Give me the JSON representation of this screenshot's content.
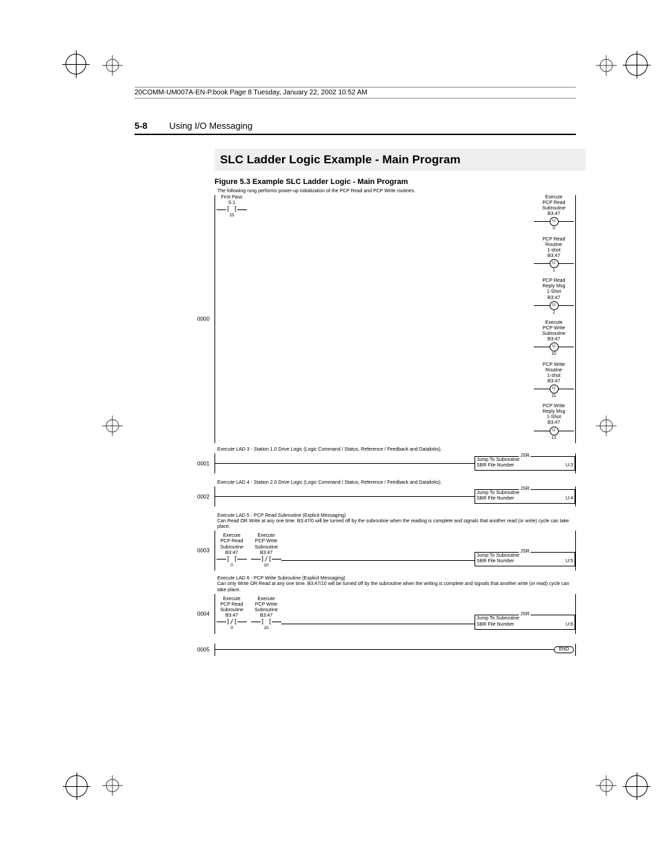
{
  "header_line": "20COMM-UM007A-EN-P.book  Page 8  Tuesday, January 22, 2002  10:52 AM",
  "page_number": "5-8",
  "chapter_title": "Using I/O Messaging",
  "section_title": "SLC Ladder Logic Example - Main Program",
  "figure_caption": "Figure 5.3   Example SLC Ladder Logic - Main Program",
  "rung0": {
    "num": "0000",
    "desc": "The following rung performs power-up initialization of the PCP Read and PCP Write routines.",
    "contact": {
      "l1": "First Pass",
      "l2": "S:1",
      "sub": "15"
    },
    "outputs": [
      {
        "l1": "Execute",
        "l2": "PCP Read",
        "l3": "Subroutine",
        "addr": "B3:47",
        "coil": "U",
        "sub": "0"
      },
      {
        "l1": "PCP Read",
        "l2": "Routine",
        "l3": "1-shot",
        "addr": "B3:47",
        "coil": "U",
        "sub": "1"
      },
      {
        "l1": "PCP Read",
        "l2": "Reply Msg",
        "l3": "1-Shot",
        "addr": "B3:47",
        "coil": "U",
        "sub": "2"
      },
      {
        "l1": "Execute",
        "l2": "PCP Write",
        "l3": "Subroutine",
        "addr": "B3:47",
        "coil": "U",
        "sub": "10"
      },
      {
        "l1": "PCP Write",
        "l2": "Routine",
        "l3": "1-shot",
        "addr": "B3:47",
        "coil": "U",
        "sub": "11"
      },
      {
        "l1": "PCP Write",
        "l2": "Reply Msg",
        "l3": "1-Shot",
        "addr": "B3:47",
        "coil": "U",
        "sub": "12"
      }
    ]
  },
  "rung1": {
    "num": "0001",
    "desc": "Execute LAD 3 - Station 1.0 Drive Logic (Logic Command / Status, Reference / Feedback and Datalinks).",
    "jsr": {
      "label": "JSR",
      "l1": "Jump To Subroutine",
      "l2": "SBR File Number",
      "v": "U:3"
    }
  },
  "rung2": {
    "num": "0002",
    "desc": "Execute LAD 4 - Station 2.0 Drive Logic  (Logic Command / Status, Reference / Feedback and Datalinks).",
    "jsr": {
      "label": "JSR",
      "l1": "Jump To Subroutine",
      "l2": "SBR File Number",
      "v": "U:4"
    }
  },
  "rung3": {
    "num": "0003",
    "desc": "Execute LAD 5 - PCP Read Subroutine (Explicit Messaging)\nCan Read OR Write at any one time.  B3:47/0 will be turned off by the subroutine when the reading is complete and signals that another read (or write) cycle can take place.",
    "c1": {
      "l1": "Execute",
      "l2": "PCP Read",
      "l3": "Subroutine",
      "addr": "B3:47",
      "sub": "0"
    },
    "c2": {
      "l1": "Execute",
      "l2": "PCP Write",
      "l3": "Subroutine",
      "addr": "B3:47",
      "sub": "10"
    },
    "jsr": {
      "label": "JSR",
      "l1": "Jump To Subroutine",
      "l2": "SBR File Number",
      "v": "U:5"
    }
  },
  "rung4": {
    "num": "0004",
    "desc": "Execute LAD 6 - PCP Write Subroutine (Explicit Messaging)\nCan only Write OR Read at any one time.   B3:47/10 will be turned off by the subroutine when the writing is complete and signals that another write (or read) cycle can take place.",
    "c1": {
      "l1": "Execute",
      "l2": "PCP Read",
      "l3": "Subroutine",
      "addr": "B3:47",
      "sub": "0"
    },
    "c2": {
      "l1": "Execute",
      "l2": "PCP Write",
      "l3": "Subroutine",
      "addr": "B3:47",
      "sub": "10"
    },
    "jsr": {
      "label": "JSR",
      "l1": "Jump To Subroutine",
      "l2": "SBR File Number",
      "v": "U:6"
    }
  },
  "rung5": {
    "num": "0005",
    "end": "END"
  }
}
